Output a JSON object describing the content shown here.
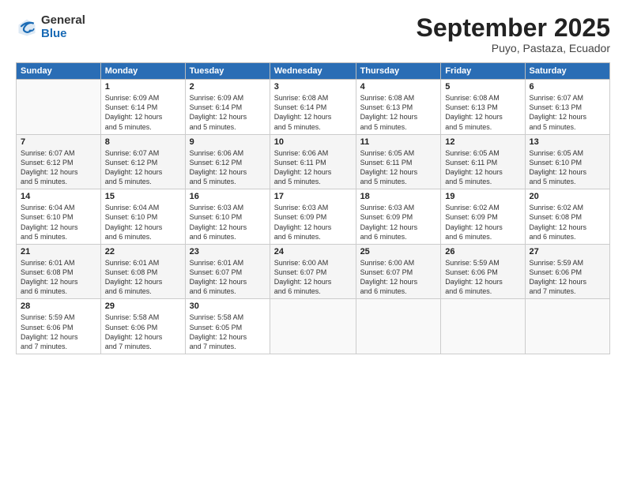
{
  "header": {
    "logo_general": "General",
    "logo_blue": "Blue",
    "title": "September 2025",
    "subtitle": "Puyo, Pastaza, Ecuador"
  },
  "days_of_week": [
    "Sunday",
    "Monday",
    "Tuesday",
    "Wednesday",
    "Thursday",
    "Friday",
    "Saturday"
  ],
  "weeks": [
    [
      {
        "num": "",
        "info": ""
      },
      {
        "num": "1",
        "info": "Sunrise: 6:09 AM\nSunset: 6:14 PM\nDaylight: 12 hours\nand 5 minutes."
      },
      {
        "num": "2",
        "info": "Sunrise: 6:09 AM\nSunset: 6:14 PM\nDaylight: 12 hours\nand 5 minutes."
      },
      {
        "num": "3",
        "info": "Sunrise: 6:08 AM\nSunset: 6:14 PM\nDaylight: 12 hours\nand 5 minutes."
      },
      {
        "num": "4",
        "info": "Sunrise: 6:08 AM\nSunset: 6:13 PM\nDaylight: 12 hours\nand 5 minutes."
      },
      {
        "num": "5",
        "info": "Sunrise: 6:08 AM\nSunset: 6:13 PM\nDaylight: 12 hours\nand 5 minutes."
      },
      {
        "num": "6",
        "info": "Sunrise: 6:07 AM\nSunset: 6:13 PM\nDaylight: 12 hours\nand 5 minutes."
      }
    ],
    [
      {
        "num": "7",
        "info": "Sunrise: 6:07 AM\nSunset: 6:12 PM\nDaylight: 12 hours\nand 5 minutes."
      },
      {
        "num": "8",
        "info": "Sunrise: 6:07 AM\nSunset: 6:12 PM\nDaylight: 12 hours\nand 5 minutes."
      },
      {
        "num": "9",
        "info": "Sunrise: 6:06 AM\nSunset: 6:12 PM\nDaylight: 12 hours\nand 5 minutes."
      },
      {
        "num": "10",
        "info": "Sunrise: 6:06 AM\nSunset: 6:11 PM\nDaylight: 12 hours\nand 5 minutes."
      },
      {
        "num": "11",
        "info": "Sunrise: 6:05 AM\nSunset: 6:11 PM\nDaylight: 12 hours\nand 5 minutes."
      },
      {
        "num": "12",
        "info": "Sunrise: 6:05 AM\nSunset: 6:11 PM\nDaylight: 12 hours\nand 5 minutes."
      },
      {
        "num": "13",
        "info": "Sunrise: 6:05 AM\nSunset: 6:10 PM\nDaylight: 12 hours\nand 5 minutes."
      }
    ],
    [
      {
        "num": "14",
        "info": "Sunrise: 6:04 AM\nSunset: 6:10 PM\nDaylight: 12 hours\nand 5 minutes."
      },
      {
        "num": "15",
        "info": "Sunrise: 6:04 AM\nSunset: 6:10 PM\nDaylight: 12 hours\nand 6 minutes."
      },
      {
        "num": "16",
        "info": "Sunrise: 6:03 AM\nSunset: 6:10 PM\nDaylight: 12 hours\nand 6 minutes."
      },
      {
        "num": "17",
        "info": "Sunrise: 6:03 AM\nSunset: 6:09 PM\nDaylight: 12 hours\nand 6 minutes."
      },
      {
        "num": "18",
        "info": "Sunrise: 6:03 AM\nSunset: 6:09 PM\nDaylight: 12 hours\nand 6 minutes."
      },
      {
        "num": "19",
        "info": "Sunrise: 6:02 AM\nSunset: 6:09 PM\nDaylight: 12 hours\nand 6 minutes."
      },
      {
        "num": "20",
        "info": "Sunrise: 6:02 AM\nSunset: 6:08 PM\nDaylight: 12 hours\nand 6 minutes."
      }
    ],
    [
      {
        "num": "21",
        "info": "Sunrise: 6:01 AM\nSunset: 6:08 PM\nDaylight: 12 hours\nand 6 minutes."
      },
      {
        "num": "22",
        "info": "Sunrise: 6:01 AM\nSunset: 6:08 PM\nDaylight: 12 hours\nand 6 minutes."
      },
      {
        "num": "23",
        "info": "Sunrise: 6:01 AM\nSunset: 6:07 PM\nDaylight: 12 hours\nand 6 minutes."
      },
      {
        "num": "24",
        "info": "Sunrise: 6:00 AM\nSunset: 6:07 PM\nDaylight: 12 hours\nand 6 minutes."
      },
      {
        "num": "25",
        "info": "Sunrise: 6:00 AM\nSunset: 6:07 PM\nDaylight: 12 hours\nand 6 minutes."
      },
      {
        "num": "26",
        "info": "Sunrise: 5:59 AM\nSunset: 6:06 PM\nDaylight: 12 hours\nand 6 minutes."
      },
      {
        "num": "27",
        "info": "Sunrise: 5:59 AM\nSunset: 6:06 PM\nDaylight: 12 hours\nand 7 minutes."
      }
    ],
    [
      {
        "num": "28",
        "info": "Sunrise: 5:59 AM\nSunset: 6:06 PM\nDaylight: 12 hours\nand 7 minutes."
      },
      {
        "num": "29",
        "info": "Sunrise: 5:58 AM\nSunset: 6:06 PM\nDaylight: 12 hours\nand 7 minutes."
      },
      {
        "num": "30",
        "info": "Sunrise: 5:58 AM\nSunset: 6:05 PM\nDaylight: 12 hours\nand 7 minutes."
      },
      {
        "num": "",
        "info": ""
      },
      {
        "num": "",
        "info": ""
      },
      {
        "num": "",
        "info": ""
      },
      {
        "num": "",
        "info": ""
      }
    ]
  ]
}
